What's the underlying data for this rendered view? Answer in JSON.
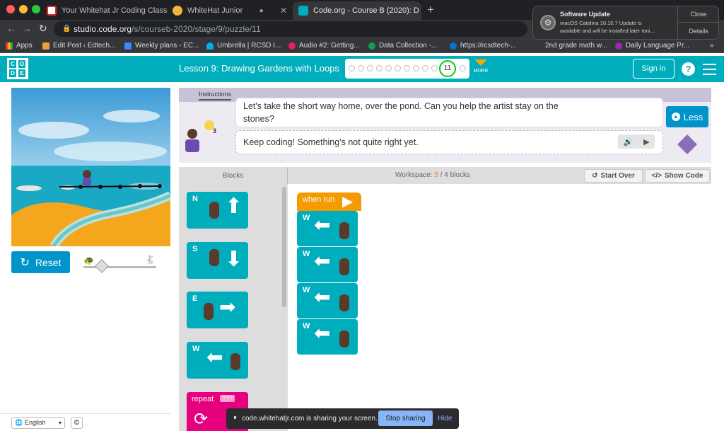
{
  "browser": {
    "tabs": [
      {
        "title": "Your Whitehat Jr Coding Class"
      },
      {
        "title": "WhiteHat Junior"
      },
      {
        "title": "Code.org - Course B (2020): D"
      }
    ],
    "url_host": "studio.code.org",
    "url_path": "/s/courseb-2020/stage/9/puzzle/11",
    "bookmarks": [
      "Apps",
      "Edit Post ‹ Edtech...",
      "Weekly plans - EC...",
      "Umbrella | RCSD I...",
      "Audio #2: Getting...",
      "Data Collection -...",
      "https://rcsdtech-...",
      "2nd grade math w...",
      "Daily Language Pr..."
    ],
    "bookmarks_more": "»"
  },
  "notification": {
    "title": "Software Update",
    "body_line1": "macOS Catalina 10.15.7 Update is",
    "body_line2": "available and will be installed later toni...",
    "close_label": "Close",
    "details_label": "Details"
  },
  "header": {
    "logo_letters": [
      "C",
      "O",
      "D",
      "E"
    ],
    "lesson_title": "Lesson 9: Drawing Gardens with Loops",
    "current_puzzle": "11",
    "more_label": "MORE",
    "signin_label": "Sign in",
    "help_glyph": "?"
  },
  "game": {
    "reset_label": "Reset"
  },
  "instructions": {
    "tab_label": "Instructions",
    "line1_part1": "Let's take the short way home, over the pond. Can you help the artist stay on the",
    "line1_part2": "stones?",
    "hint_count": "3",
    "feedback": "Keep coding! Something's not quite right yet.",
    "less_label": "Less"
  },
  "workspace": {
    "blocks_label": "Blocks",
    "workspace_label": "Workspace:",
    "block_count": "5",
    "block_limit": "/ 4 blocks",
    "start_over_label": "Start Over",
    "show_code_label": "Show Code",
    "toolbox_blocks": [
      {
        "dir": "N"
      },
      {
        "dir": "S"
      },
      {
        "dir": "E"
      },
      {
        "dir": "W"
      }
    ],
    "repeat_label": "repeat",
    "repeat_value": "???",
    "when_run_label": "when run",
    "program_blocks": [
      {
        "dir": "W"
      },
      {
        "dir": "W"
      },
      {
        "dir": "W"
      },
      {
        "dir": "W"
      }
    ]
  },
  "footer": {
    "language": "English",
    "copyright_glyph": "©"
  },
  "sharing": {
    "message": "code.whitehatjr.com is sharing your screen.",
    "stop_label": "Stop sharing",
    "hide_label": "Hide"
  }
}
